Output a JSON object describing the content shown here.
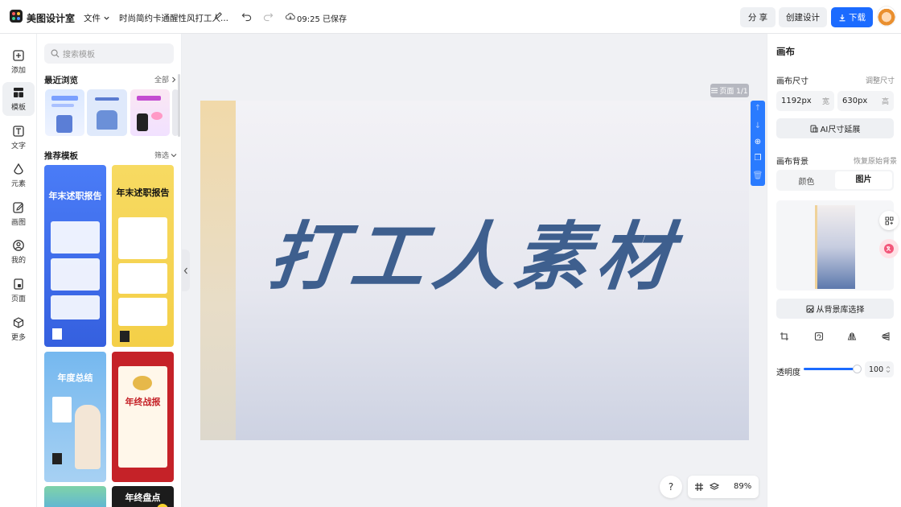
{
  "topbar": {
    "app_name": "美图设计室",
    "file_menu": "文件",
    "doc_title": "时尚简约卡通醒性风打工人...",
    "save_status": "09:25 已保存",
    "share_label": "分 享",
    "create_label": "创建设计",
    "download_label": "下载"
  },
  "rail": {
    "items": [
      {
        "label": "添加",
        "icon": "add-icon"
      },
      {
        "label": "模板",
        "icon": "template-icon"
      },
      {
        "label": "文字",
        "icon": "text-icon"
      },
      {
        "label": "元素",
        "icon": "element-icon"
      },
      {
        "label": "画图",
        "icon": "draw-icon"
      },
      {
        "label": "我的",
        "icon": "user-icon"
      },
      {
        "label": "页面",
        "icon": "page-icon"
      },
      {
        "label": "更多",
        "icon": "more-icon"
      }
    ]
  },
  "panel": {
    "search_placeholder": "搜索模板",
    "recent_title": "最近浏览",
    "recent_all": "全部",
    "recommended_title": "推荐模板",
    "filter_label": "筛选",
    "cards": [
      {
        "title": "年末述职报告",
        "bg": "#3f6df0"
      },
      {
        "title": "年末述职报告",
        "bg": "#f6d763"
      },
      {
        "title": "年度总结",
        "bg": "#7dbbee"
      },
      {
        "title": "年终战报",
        "bg": "#c9242a"
      },
      {
        "title": "",
        "bg": "#6fc4a6"
      },
      {
        "title": "年终盘点",
        "bg": "#1c1c1c"
      }
    ]
  },
  "canvas": {
    "page_indicator": "页面 1/1",
    "main_text": "打工人素材",
    "zoom": "89%",
    "help": "?"
  },
  "right_panel": {
    "title": "画布",
    "size_label": "画布尺寸",
    "resize_link": "调整尺寸",
    "width_value": "1192px",
    "width_unit": "宽",
    "height_value": "630px",
    "height_unit": "高",
    "ai_resize": "AI尺寸延展",
    "bg_label": "画布背景",
    "restore_bg": "恢复原始背景",
    "tab_color": "颜色",
    "tab_image": "图片",
    "bg_library": "从背景库选择",
    "opacity_label": "透明度",
    "opacity_value": "100"
  },
  "colors": {
    "accent": "#1b6bff",
    "title_blue": "#3e5f8e"
  }
}
